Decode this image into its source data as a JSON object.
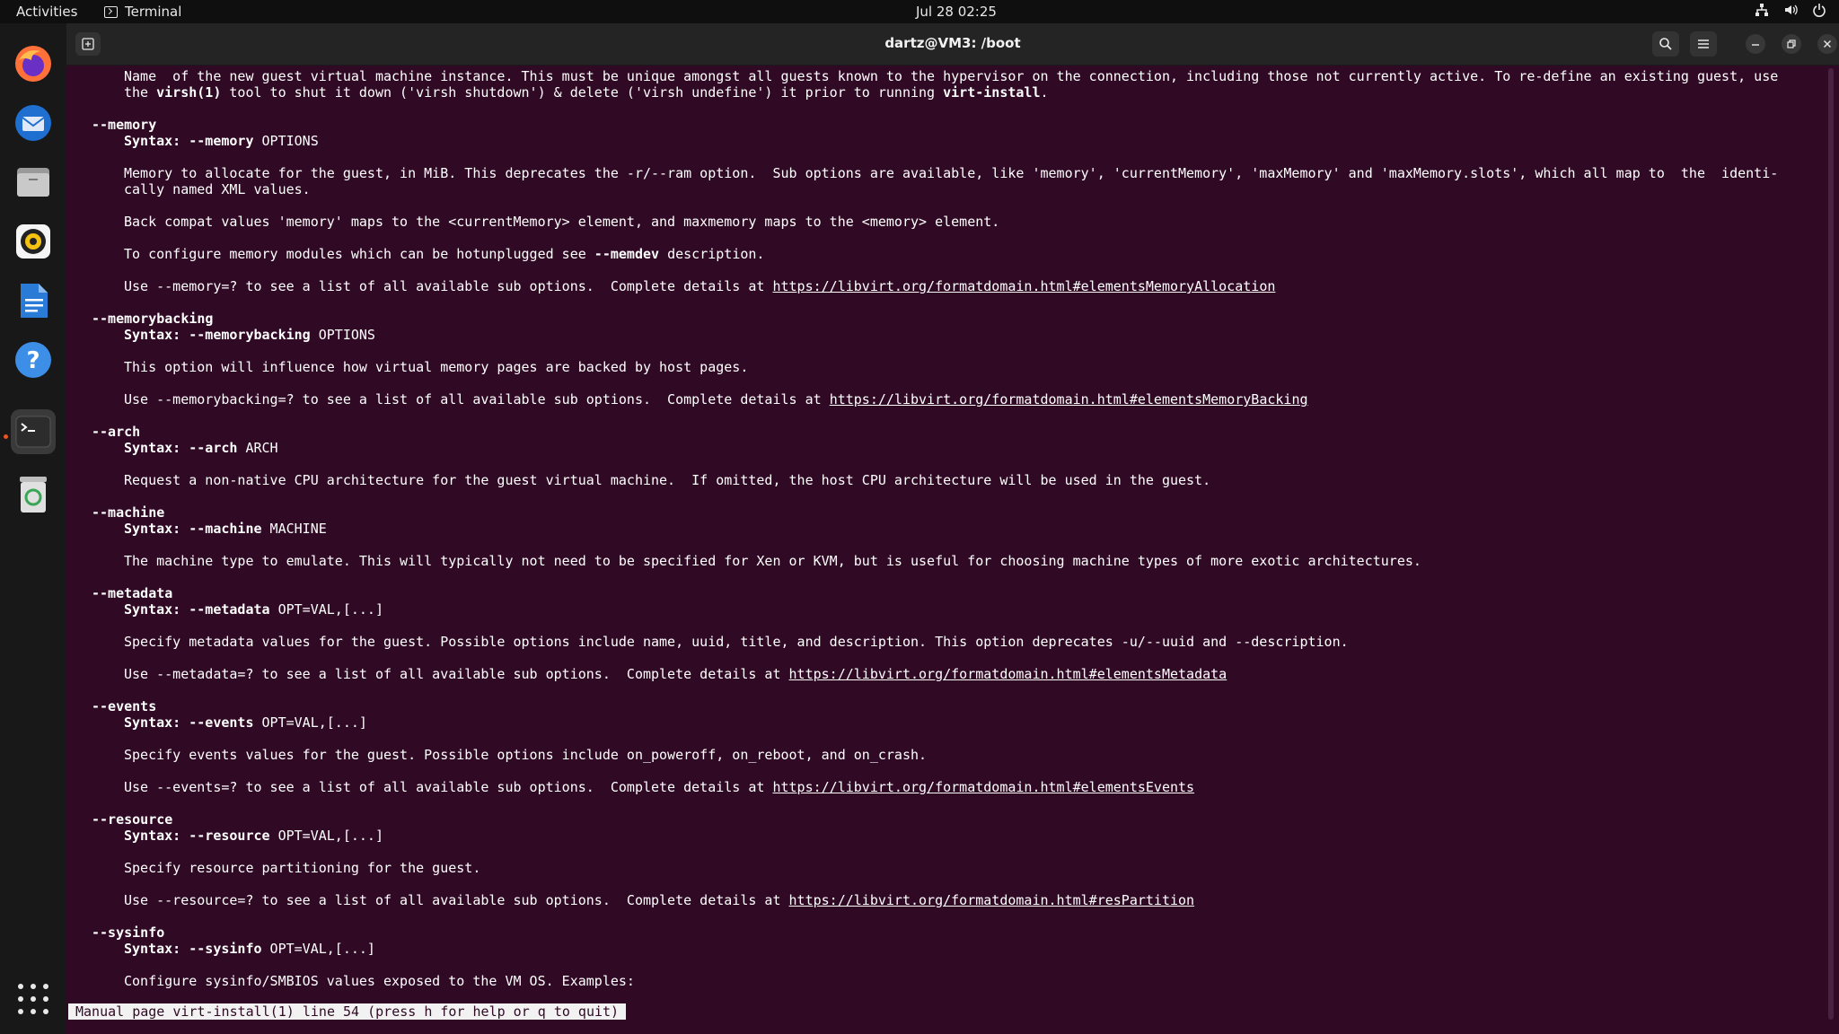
{
  "topbar": {
    "activities": "Activities",
    "app_name": "Terminal",
    "clock": "Jul 28  02:25"
  },
  "dock": {
    "items": [
      "firefox-icon",
      "thunderbird-icon",
      "files-icon",
      "rhythmbox-icon",
      "libreoffice-writer-icon",
      "help-icon",
      "terminal-icon",
      "trash-icon"
    ]
  },
  "window": {
    "title": "dartz@VM3: /boot"
  },
  "colors": {
    "terminal_bg": "#300a24",
    "accent": "#e95420"
  },
  "man": {
    "l0": "Name  of the new guest virtual machine instance. This must be unique amongst all guests known to the hypervisor on the connection, including those not currently active. To re-define an existing guest, use",
    "l1a": "the ",
    "l1b": "virsh(1)",
    "l1c": " tool to shut it down ('virsh shutdown') & delete ('virsh undefine') it prior to running ",
    "l1d": "virt-install",
    "l1e": ".",
    "memory": {
      "opt": "--memory",
      "syn_a": "Syntax: --memory",
      "syn_b": " OPTIONS",
      "d1": "Memory to allocate for the guest, in MiB. This deprecates the -r/--ram option.  Sub options are available, like 'memory', 'currentMemory', 'maxMemory' and 'maxMemory.slots', which all map to  the  identi-",
      "d2": "cally named XML values.",
      "d3": "Back compat values 'memory' maps to the <currentMemory> element, and maxmemory maps to the <memory> element.",
      "d4a": "To configure memory modules which can be hotunplugged see ",
      "d4b": "--memdev",
      "d4c": " description.",
      "use": "Use --memory=? to see a list of all available sub options.  Complete details at ",
      "link": "https://libvirt.org/formatdomain.html#elementsMemoryAllocation"
    },
    "memorybacking": {
      "opt": "--memorybacking",
      "syn_a": "Syntax: --memorybacking",
      "syn_b": " OPTIONS",
      "d1": "This option will influence how virtual memory pages are backed by host pages.",
      "use": "Use --memorybacking=? to see a list of all available sub options.  Complete details at ",
      "link": "https://libvirt.org/formatdomain.html#elementsMemoryBacking"
    },
    "arch": {
      "opt": "--arch",
      "syn_a": "Syntax: --arch",
      "syn_b": " ARCH",
      "d1": "Request a non-native CPU architecture for the guest virtual machine.  If omitted, the host CPU architecture will be used in the guest."
    },
    "machine": {
      "opt": "--machine",
      "syn_a": "Syntax: --machine",
      "syn_b": " MACHINE",
      "d1": "The machine type to emulate. This will typically not need to be specified for Xen or KVM, but is useful for choosing machine types of more exotic architectures."
    },
    "metadata": {
      "opt": "--metadata",
      "syn_a": "Syntax: --metadata",
      "syn_b": " OPT=VAL,[...]",
      "d1": "Specify metadata values for the guest. Possible options include name, uuid, title, and description. This option deprecates -u/--uuid and --description.",
      "use": "Use --metadata=? to see a list of all available sub options.  Complete details at ",
      "link": "https://libvirt.org/formatdomain.html#elementsMetadata"
    },
    "events": {
      "opt": "--events",
      "syn_a": "Syntax: --events",
      "syn_b": " OPT=VAL,[...]",
      "d1": "Specify events values for the guest. Possible options include on_poweroff, on_reboot, and on_crash.",
      "use": "Use --events=? to see a list of all available sub options.  Complete details at ",
      "link": "https://libvirt.org/formatdomain.html#elementsEvents"
    },
    "resource": {
      "opt": "--resource",
      "syn_a": "Syntax: --resource",
      "syn_b": " OPT=VAL,[...]",
      "d1": "Specify resource partitioning for the guest.",
      "use": "Use --resource=? to see a list of all available sub options.  Complete details at ",
      "link": "https://libvirt.org/formatdomain.html#resPartition"
    },
    "sysinfo": {
      "opt": "--sysinfo",
      "syn_a": "Syntax: --sysinfo",
      "syn_b": " OPT=VAL,[...]",
      "d1": "Configure sysinfo/SMBIOS values exposed to the VM OS. Examples:"
    }
  },
  "status": "Manual page virt-install(1) line 54 (press h for help or q to quit)"
}
